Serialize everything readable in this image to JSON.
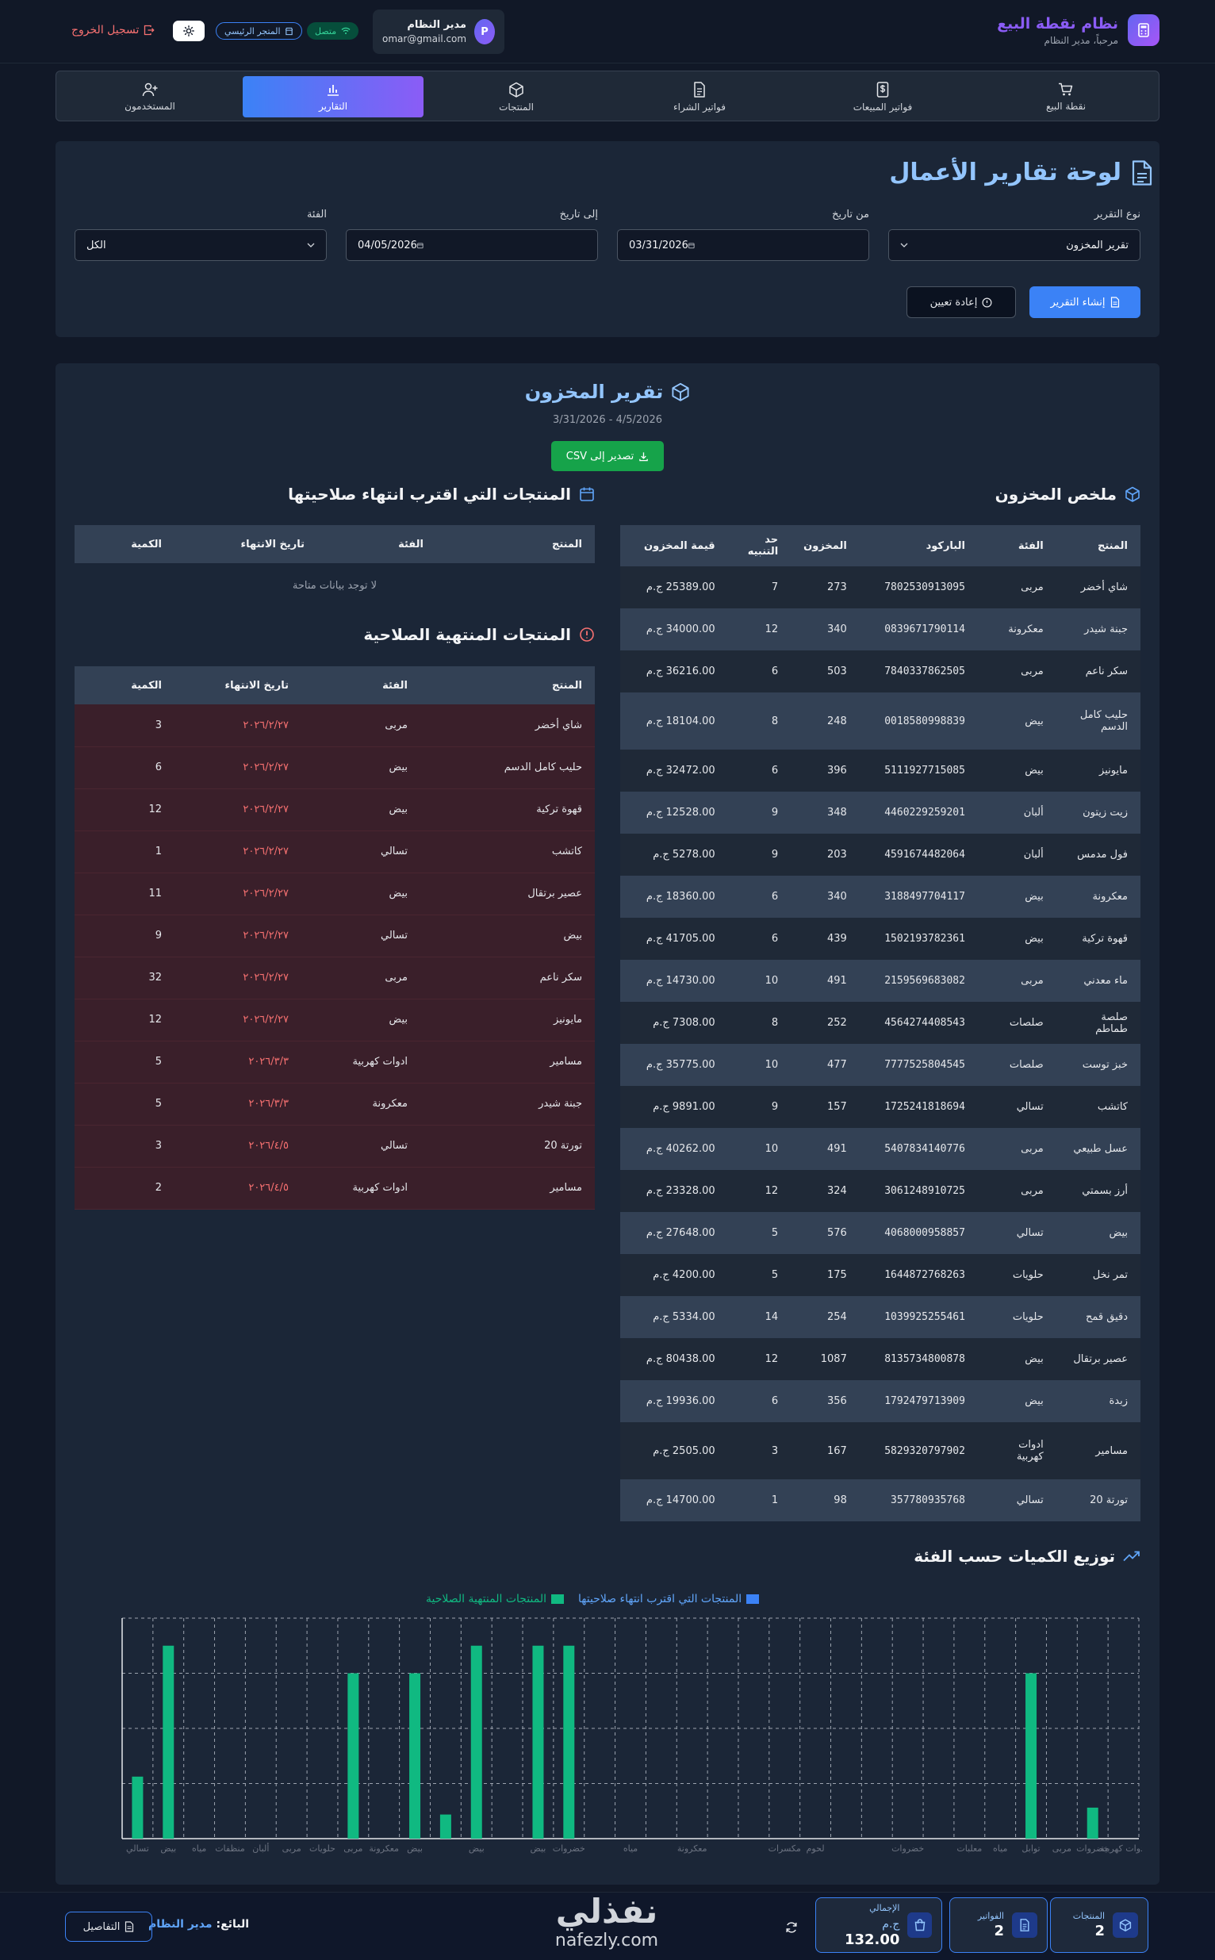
{
  "header": {
    "brand_title": "نظام نقطة البيع",
    "brand_subtitle": "مرحباً، مدير النظام",
    "user_initial": "P",
    "user_name": "مدير النظام",
    "user_email": "omar@gmail.com",
    "status": "متصل",
    "store": "المتجر الرئيسي",
    "logout": "تسجيل الخروج"
  },
  "nav": [
    {
      "label": "نقطة البيع",
      "icon": "cart-icon"
    },
    {
      "label": "فواتير المبيعات",
      "icon": "dollar-doc-icon"
    },
    {
      "label": "فواتير الشراء",
      "icon": "document-icon"
    },
    {
      "label": "المنتجات",
      "icon": "box-icon"
    },
    {
      "label": "التقارير",
      "icon": "bar-chart-icon",
      "active": true
    },
    {
      "label": "المستخدمون",
      "icon": "user-plus-icon"
    }
  ],
  "filters": {
    "title": "لوحة تقارير الأعمال",
    "report_type_label": "نوع التقرير",
    "report_type_value": "تقرير المخزون",
    "from_label": "من تاريخ",
    "from_value": "03/31/2026",
    "to_label": "إلى تاريخ",
    "to_value": "04/05/2026",
    "category_label": "الفئة",
    "category_value": "الكل",
    "generate": "إنشاء التقرير",
    "reset": "إعادة تعيين"
  },
  "report": {
    "title": "تقرير المخزون",
    "range": "3/31/2026 - 4/5/2026",
    "export": "تصدير إلى CSV",
    "stock_title": "ملخص المخزون",
    "stock_headers": [
      "المنتج",
      "الفئة",
      "الباركود",
      "المخزون",
      "حد التنبيه",
      "قيمة المخزون"
    ],
    "stock_rows": [
      [
        "شاي أخضر",
        "مربى",
        "7802530913095",
        "273",
        "7",
        "25389.00 ج.م"
      ],
      [
        "جبنة شيدر",
        "معكرونة",
        "0839671790114",
        "340",
        "12",
        "34000.00 ج.م"
      ],
      [
        "سكر ناعم",
        "مربى",
        "7840337862505",
        "503",
        "6",
        "36216.00 ج.م"
      ],
      [
        "حليب كامل الدسم",
        "بيض",
        "0018580998839",
        "248",
        "8",
        "18104.00 ج.م"
      ],
      [
        "مايونيز",
        "بيض",
        "5111927715085",
        "396",
        "6",
        "32472.00 ج.م"
      ],
      [
        "زيت زيتون",
        "ألبان",
        "4460229259201",
        "348",
        "9",
        "12528.00 ج.م"
      ],
      [
        "فول مدمس",
        "ألبان",
        "4591674482064",
        "203",
        "9",
        "5278.00 ج.م"
      ],
      [
        "معكرونة",
        "بيض",
        "3188497704117",
        "340",
        "6",
        "18360.00 ج.م"
      ],
      [
        "قهوة تركية",
        "بيض",
        "1502193782361",
        "439",
        "6",
        "41705.00 ج.م"
      ],
      [
        "ماء معدني",
        "مربى",
        "2159569683082",
        "491",
        "10",
        "14730.00 ج.م"
      ],
      [
        "صلصة طماطم",
        "صلصات",
        "4564274408543",
        "252",
        "8",
        "7308.00 ج.م"
      ],
      [
        "خبز توست",
        "صلصات",
        "7777525804545",
        "477",
        "10",
        "35775.00 ج.م"
      ],
      [
        "كاتشب",
        "تسالي",
        "1725241818694",
        "157",
        "9",
        "9891.00 ج.م"
      ],
      [
        "عسل طبيعي",
        "مربى",
        "5407834140776",
        "491",
        "10",
        "40262.00 ج.م"
      ],
      [
        "أرز بسمتي",
        "مربى",
        "3061248910725",
        "324",
        "12",
        "23328.00 ج.م"
      ],
      [
        "بيض",
        "تسالي",
        "4068000958857",
        "576",
        "5",
        "27648.00 ج.م"
      ],
      [
        "تمر نخل",
        "حلويات",
        "1644872768263",
        "175",
        "5",
        "4200.00 ج.م"
      ],
      [
        "دقيق قمح",
        "حلويات",
        "1039925255461",
        "254",
        "14",
        "5334.00 ج.م"
      ],
      [
        "عصير برتقال",
        "بيض",
        "8135734800878",
        "1087",
        "12",
        "80438.00 ج.م"
      ],
      [
        "زبدة",
        "بيض",
        "1792479713909",
        "356",
        "6",
        "19936.00 ج.م"
      ],
      [
        "مسامير",
        "ادوات كهربية",
        "5829320797902",
        "167",
        "3",
        "2505.00 ج.م"
      ],
      [
        "تورتة 20",
        "تسالي",
        "357780935768",
        "98",
        "1",
        "14700.00 ج.م"
      ]
    ],
    "soon_title": "المنتجات التي اقترب انتهاء صلاحيتها",
    "soon_headers": [
      "المنتج",
      "الفئة",
      "تاريخ الانتهاء",
      "الكمية"
    ],
    "soon_empty": "لا توجد بيانات متاحة",
    "expired_title": "المنتجات المنتهية الصلاحية",
    "expired_headers": [
      "المنتج",
      "الفئة",
      "تاريخ الانتهاء",
      "الكمية"
    ],
    "expired_rows": [
      [
        "شاي أخضر",
        "مربى",
        "٢٠٢٦/٢/٢٧",
        "3"
      ],
      [
        "حليب كامل الدسم",
        "بيض",
        "٢٠٢٦/٢/٢٧",
        "6"
      ],
      [
        "قهوة تركية",
        "بيض",
        "٢٠٢٦/٢/٢٧",
        "12"
      ],
      [
        "كاتشب",
        "تسالي",
        "٢٠٢٦/٢/٢٧",
        "1"
      ],
      [
        "عصير برتقال",
        "بيض",
        "٢٠٢٦/٢/٢٧",
        "11"
      ],
      [
        "بيض",
        "تسالي",
        "٢٠٢٦/٢/٢٧",
        "9"
      ],
      [
        "سكر ناعم",
        "مربى",
        "٢٠٢٦/٢/٢٧",
        "32"
      ],
      [
        "مايونيز",
        "بيض",
        "٢٠٢٦/٢/٢٧",
        "12"
      ],
      [
        "مسامير",
        "ادوات كهربية",
        "٢٠٢٦/٣/٣",
        "5"
      ],
      [
        "جبنة شيدر",
        "معكرونة",
        "٢٠٢٦/٣/٣",
        "5"
      ],
      [
        "تورتة 20",
        "تسالي",
        "٢٠٢٦/٤/٥",
        "3"
      ],
      [
        "مسامير",
        "ادوات كهربية",
        "٢٠٢٦/٤/٥",
        "2"
      ]
    ]
  },
  "chart_data": {
    "type": "bar",
    "title": "توزيع الكميات حسب الفئة",
    "series": [
      {
        "name": "المنتجات التي اقترب انتهاء صلاحيتها",
        "color": "#3b82f6",
        "values": [
          0,
          0,
          0,
          0,
          0,
          0,
          0,
          0,
          0,
          0,
          0,
          0,
          0,
          0,
          0,
          0,
          0,
          0,
          0,
          0,
          0,
          0,
          0,
          0,
          0,
          0,
          0,
          0,
          0,
          0,
          0,
          0
        ]
      },
      {
        "name": "المنتجات المنتهية الصلاحية",
        "color": "#10b981",
        "values": [
          9,
          28,
          0,
          0,
          0,
          0,
          0,
          24,
          0,
          24,
          3.5,
          28,
          0,
          28,
          28,
          0,
          0,
          0,
          0,
          0,
          0,
          0,
          0,
          0,
          0,
          0,
          0,
          0,
          0,
          24,
          0,
          4.5
        ]
      }
    ],
    "categories": [
      "تسالي",
      "بيض",
      "مياه",
      "منظفات",
      "ألبان",
      "مربى",
      "حلويات",
      "مربى",
      "معكرونة",
      "بيض",
      "",
      "بيض",
      "",
      "بيض",
      "خضروات",
      "",
      "مياه",
      "",
      "معكرونة",
      "",
      "",
      "مكسرات",
      "لحوم",
      "",
      "",
      "خضروات",
      "",
      "معلبات",
      "مياه",
      "توابل",
      "مربى",
      "خضروات",
      "ادوات كهربية"
    ],
    "grid": true,
    "legend": "top"
  },
  "bottom": {
    "products_label": "المنتجات",
    "products_value": "2",
    "invoices_label": "الفواتير",
    "invoices_value": "2",
    "total_label": "الإجمالي",
    "total_value": "132.00",
    "total_currency": "ج.م",
    "seller_label": "البائع:",
    "seller_name": "مدير النظام",
    "details": "التفاصيل",
    "watermark_ar": "نفذلي",
    "watermark_en": "nafezly.com"
  }
}
